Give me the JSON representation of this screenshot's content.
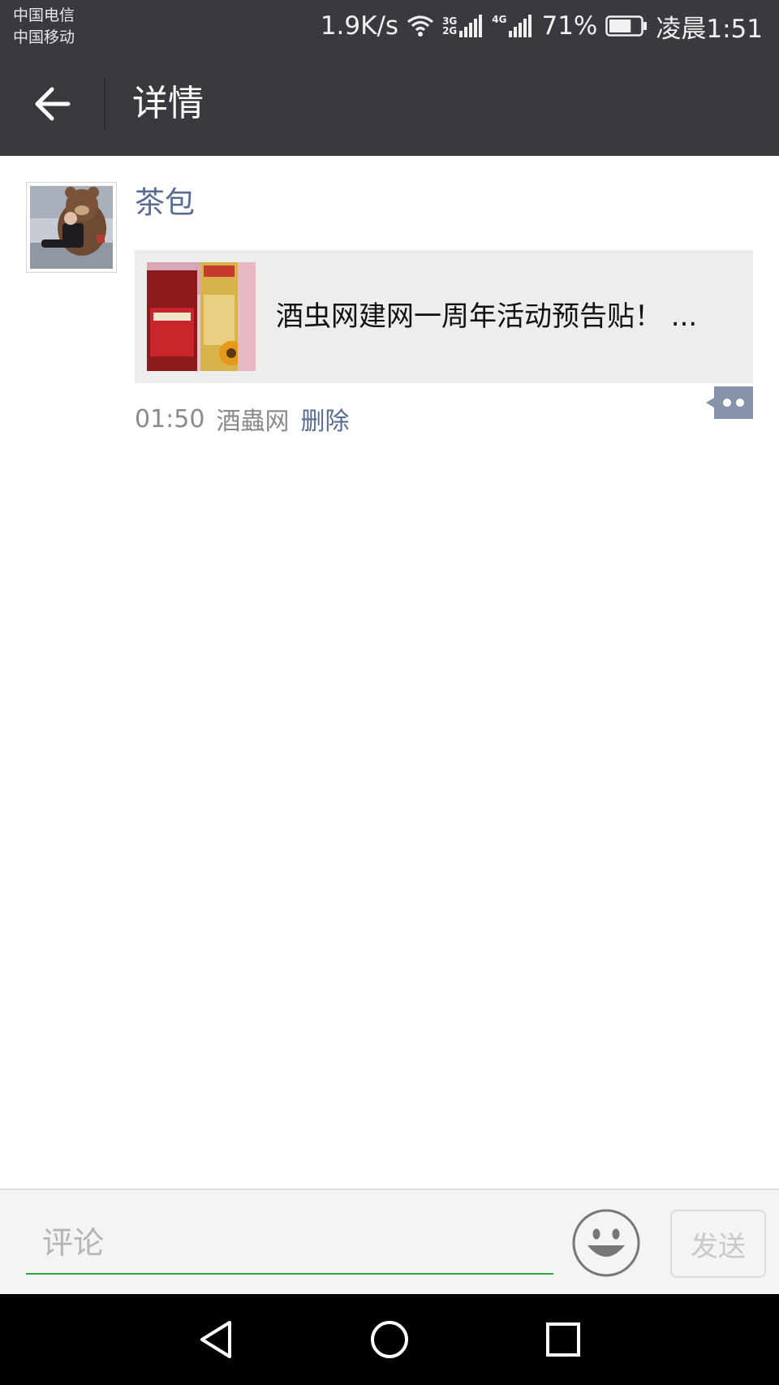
{
  "status_bar": {
    "carrier_1": "中国电信",
    "carrier_2": "中国移动",
    "speed": "1.9K/s",
    "net_label_1": "3G",
    "net_label_2": "2G",
    "net_label_3": "4G",
    "battery": "71%",
    "battery_level": 0.71,
    "time": "凌晨1:51"
  },
  "header": {
    "title": "详情",
    "back_icon": "arrow-left-icon"
  },
  "post": {
    "author": "茶包",
    "link_title": "酒虫网建网一周年活动预告贴！ ...",
    "time": "01:50",
    "source": "酒蟲网",
    "delete_label": "删除",
    "comment_icon": "comment-dots-icon"
  },
  "comment_bar": {
    "placeholder": "评论",
    "emoji_icon": "smiley-icon",
    "send_label": "发送"
  },
  "nav": {
    "back": "triangle-back-icon",
    "home": "circle-home-icon",
    "recents": "square-recents-icon"
  },
  "colors": {
    "bar_bg": "#393a3f",
    "link_blue": "#576b95",
    "accent_green": "#2bad3a",
    "card_bg": "#ededed"
  }
}
